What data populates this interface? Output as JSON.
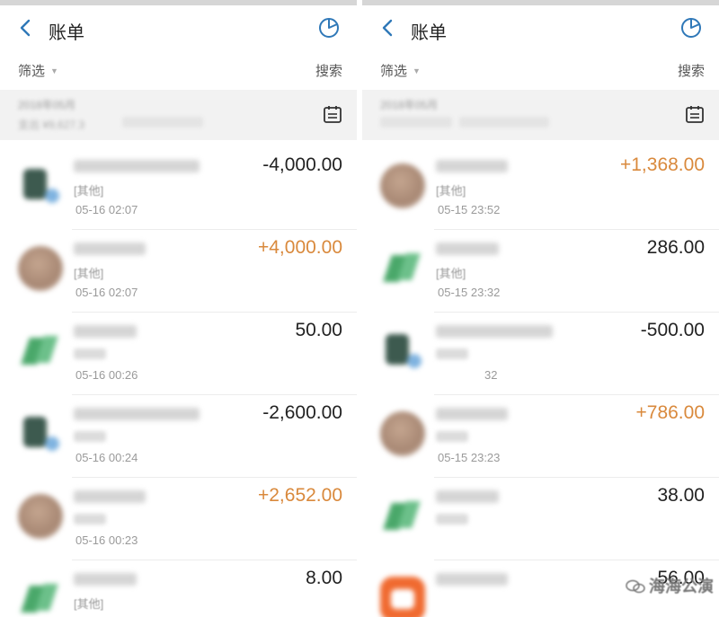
{
  "panels": [
    {
      "header": {
        "title": "账单"
      },
      "filter": {
        "label": "筛选",
        "search": "搜索"
      },
      "summary": {
        "month": "2018年05月",
        "line": "支出 ¥9,627.3"
      },
      "rows": [
        {
          "avatar": "dark",
          "category": "[其他]",
          "time": "05-16  02:07",
          "amount": "-4,000.00",
          "type": "expense",
          "blur_w": 140
        },
        {
          "avatar": "brown",
          "category": "[其他]",
          "time": "05-16  02:07",
          "amount": "+4,000.00",
          "type": "income",
          "blur_w": 80
        },
        {
          "avatar": "green",
          "category": "",
          "time": "05-16  00:26",
          "amount": "50.00",
          "type": "expense",
          "blur_w": 70
        },
        {
          "avatar": "dark",
          "category": "",
          "time": "05-16  00:24",
          "amount": "-2,600.00",
          "type": "expense",
          "blur_w": 140
        },
        {
          "avatar": "brown",
          "category": "",
          "time": "05-16  00:23",
          "amount": "+2,652.00",
          "type": "income",
          "blur_w": 80
        },
        {
          "avatar": "green",
          "category": "[其他]",
          "time": "",
          "amount": "8.00",
          "type": "expense",
          "blur_w": 70
        }
      ]
    },
    {
      "header": {
        "title": "账单"
      },
      "filter": {
        "label": "筛选",
        "search": "搜索"
      },
      "summary": {
        "month": "2018年05月",
        "line": ""
      },
      "rows": [
        {
          "avatar": "brown",
          "category": "[其他]",
          "time": "05-15  23:52",
          "amount": "+1,368.00",
          "type": "income",
          "blur_w": 80
        },
        {
          "avatar": "green",
          "category": "[其他]",
          "time": "05-15  23:32",
          "amount": "286.00",
          "type": "expense",
          "blur_w": 70
        },
        {
          "avatar": "dark",
          "category": "",
          "time": "32",
          "amount": "-500.00",
          "type": "expense",
          "blur_w": 130
        },
        {
          "avatar": "brown",
          "category": "",
          "time": "05-15  23:23",
          "amount": "+786.00",
          "type": "income",
          "blur_w": 80
        },
        {
          "avatar": "green",
          "category": "",
          "time": "",
          "amount": "38.00",
          "type": "expense",
          "blur_w": 70
        },
        {
          "avatar": "orange",
          "category": "",
          "time": "",
          "amount": "56.00",
          "type": "expense",
          "blur_w": 80
        }
      ],
      "watermark": "海海公演"
    }
  ],
  "colors": {
    "income": "#d9893c",
    "expense": "#222222",
    "accent": "#2f78b8"
  },
  "icons": {
    "back": "chevron-left-icon",
    "stats": "pie-chart-icon",
    "calendar": "calendar-icon",
    "filter_caret": "caret-down-icon"
  }
}
